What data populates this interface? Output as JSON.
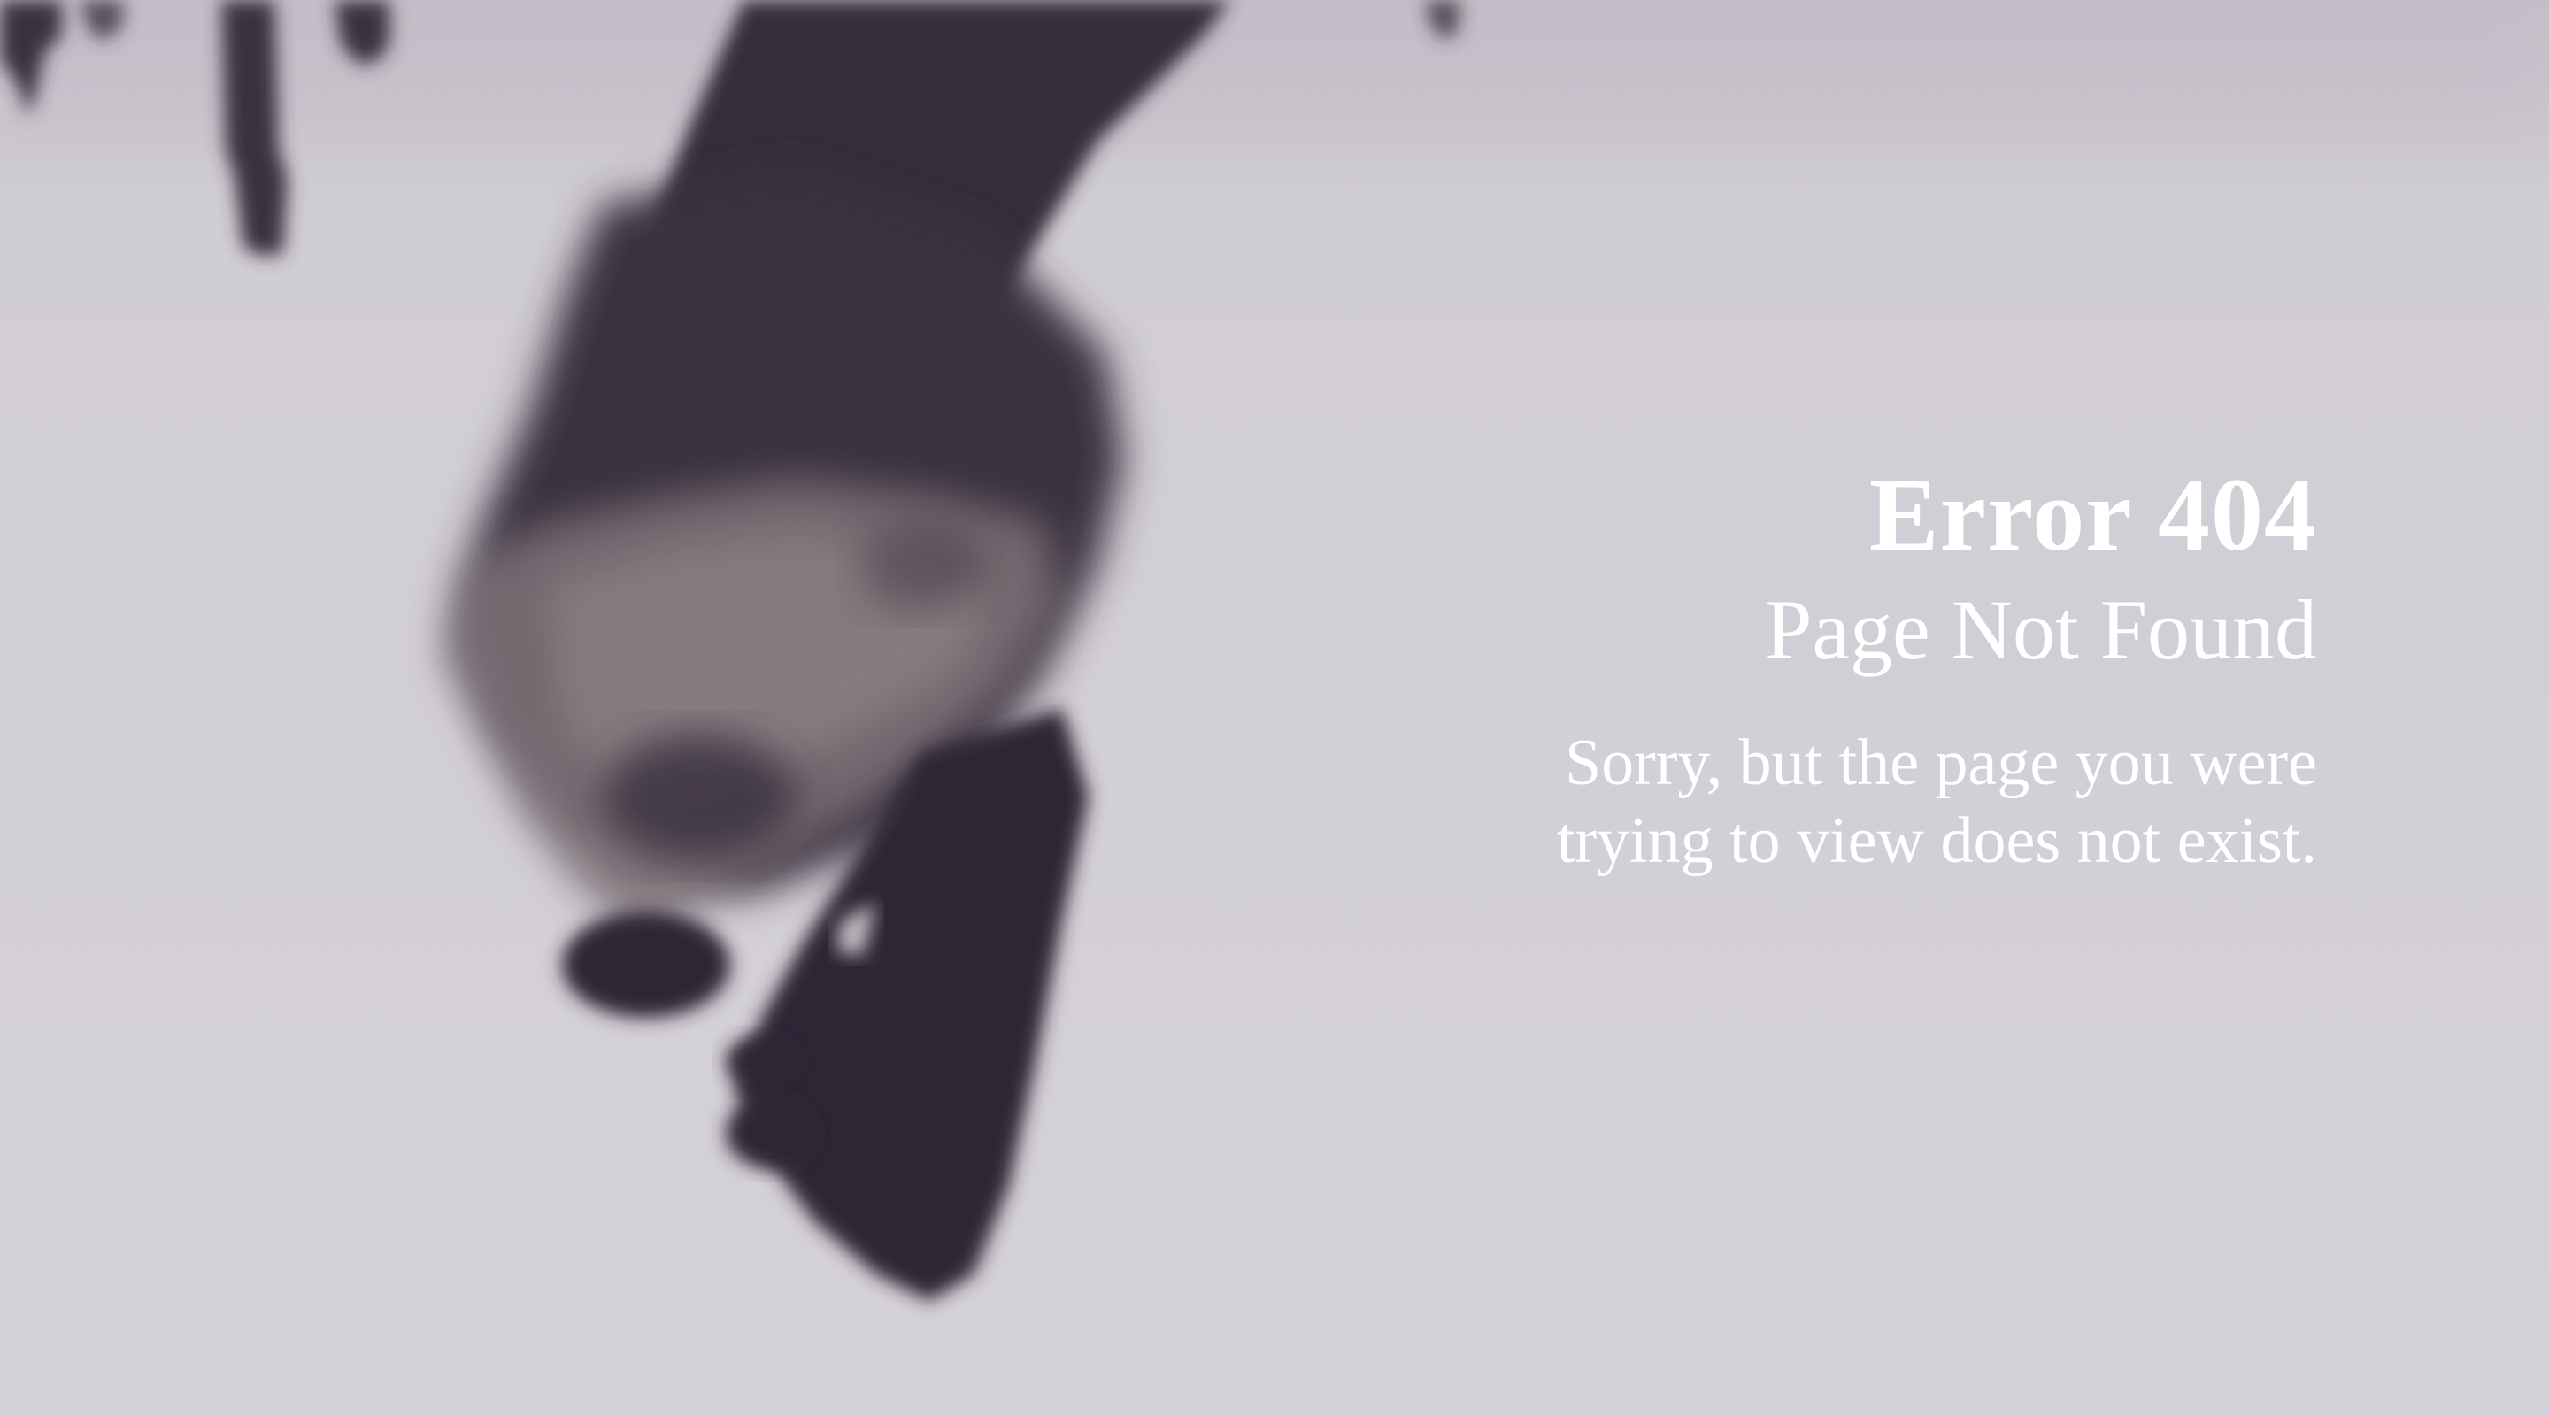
{
  "page": {
    "title": "Error 404",
    "subtitle": "Page Not Found",
    "message_line1": "Sorry, but the page you were",
    "message_line2": "trying to view does not exist."
  },
  "colors": {
    "background": "#d3cfd6",
    "text": "#ffffff",
    "figure": "#322b38"
  }
}
